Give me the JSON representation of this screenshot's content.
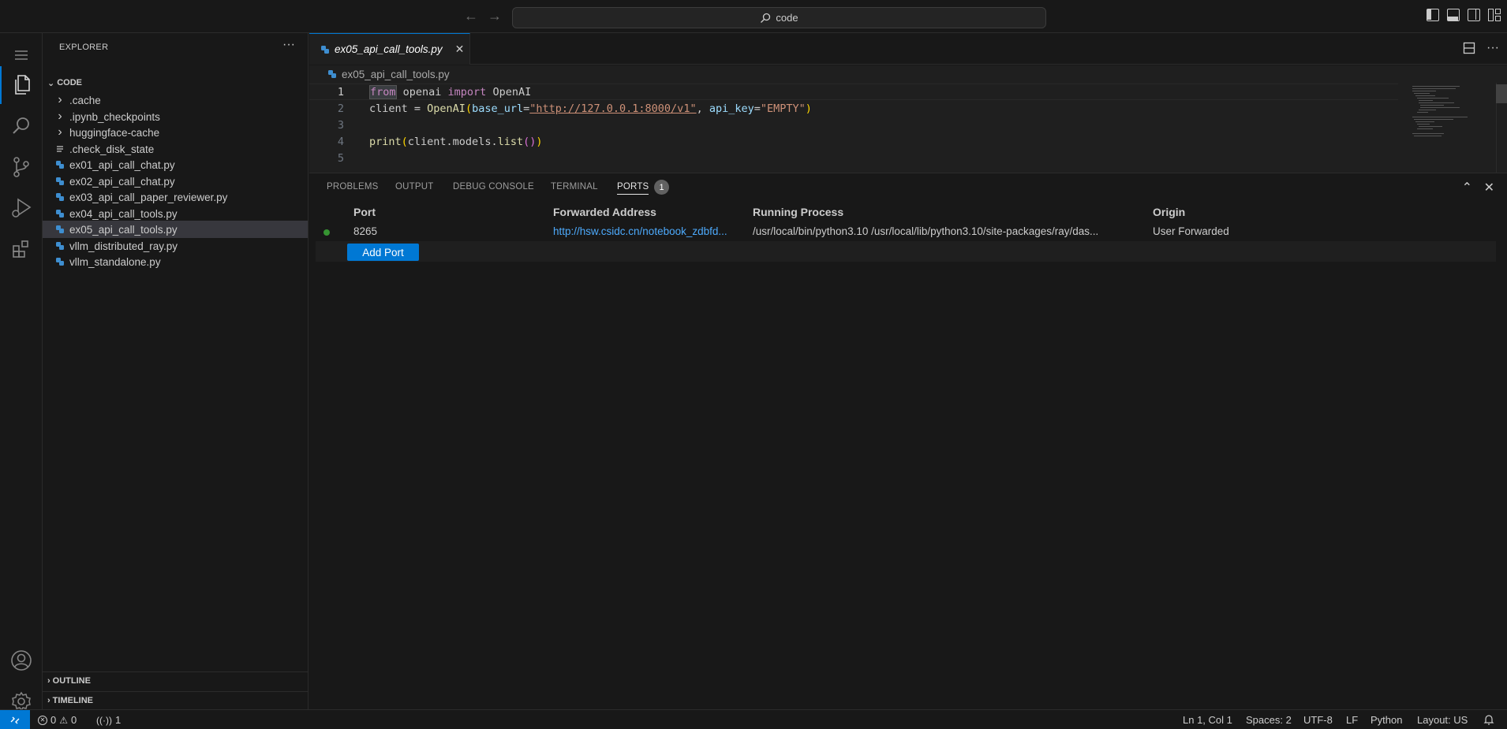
{
  "titlebar": {
    "search_text": "code",
    "back_icon": "arrow-left-icon",
    "forward_icon": "arrow-right-icon"
  },
  "sidebar": {
    "title": "EXPLORER",
    "root_label": "CODE",
    "items": [
      {
        "label": ".cache",
        "type": "folder"
      },
      {
        "label": ".ipynb_checkpoints",
        "type": "folder"
      },
      {
        "label": "huggingface-cache",
        "type": "folder"
      },
      {
        "label": ".check_disk_state",
        "type": "file"
      },
      {
        "label": "ex01_api_call_chat.py",
        "type": "python"
      },
      {
        "label": "ex02_api_call_chat.py",
        "type": "python"
      },
      {
        "label": "ex03_api_call_paper_reviewer.py",
        "type": "python"
      },
      {
        "label": "ex04_api_call_tools.py",
        "type": "python"
      },
      {
        "label": "ex05_api_call_tools.py",
        "type": "python",
        "selected": true
      },
      {
        "label": "vllm_distributed_ray.py",
        "type": "python"
      },
      {
        "label": "vllm_standalone.py",
        "type": "python"
      }
    ],
    "outline_label": "OUTLINE",
    "timeline_label": "TIMELINE"
  },
  "editor": {
    "tab_label": "ex05_api_call_tools.py",
    "breadcrumb": "ex05_api_call_tools.py",
    "line_numbers": [
      "1",
      "2",
      "3",
      "4",
      "5"
    ],
    "code": {
      "l1_from": "from",
      "l1_mid": " openai ",
      "l1_import": "import",
      "l1_end": " OpenAI",
      "l2_a": "client = ",
      "l2_fn": "OpenAI",
      "l2_open": "(",
      "l2_p1": "base_url",
      "l2_eq1": "=",
      "l2_s1": "\"http://127.0.0.1:8000/v1\"",
      "l2_comma": ", ",
      "l2_p2": "api_key",
      "l2_eq2": "=",
      "l2_s2": "\"EMPTY\"",
      "l2_close": ")",
      "l4_fn": "print",
      "l4_open": "(",
      "l4_mid": "client.models.",
      "l4_fn2": "list",
      "l4_inner": "()",
      "l4_close": ")"
    }
  },
  "panel": {
    "tabs": [
      "PROBLEMS",
      "OUTPUT",
      "DEBUG CONSOLE",
      "TERMINAL",
      "PORTS"
    ],
    "ports_badge": "1",
    "columns": [
      "Port",
      "Forwarded Address",
      "Running Process",
      "Origin"
    ],
    "row": {
      "port": "8265",
      "address": "http://hsw.csidc.cn/notebook_zdbfd...",
      "process": "/usr/local/bin/python3.10 /usr/local/lib/python3.10/site-packages/ray/das...",
      "origin": "User Forwarded",
      "status_color": "#369432"
    },
    "add_port_label": "Add Port"
  },
  "statusbar": {
    "errors": "0",
    "warnings": "0",
    "ports": "1",
    "position": "Ln 1, Col 1",
    "spaces": "Spaces: 2",
    "encoding": "UTF-8",
    "eol": "LF",
    "language": "Python",
    "layout": "Layout: US"
  },
  "colors": {
    "accent": "#0078d4",
    "link": "#4daafc",
    "python_icon": "#3e8ed0"
  }
}
